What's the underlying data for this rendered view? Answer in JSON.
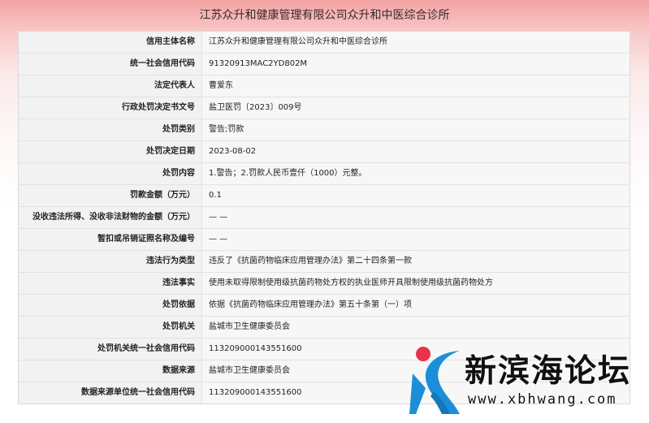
{
  "page": {
    "title": "江苏众升和健康管理有限公司众升和中医综合诊所"
  },
  "rows": [
    {
      "label": "信用主体名称",
      "value": "江苏众升和健康管理有限公司众升和中医综合诊所"
    },
    {
      "label": "统一社会信用代码",
      "value": "91320913MAC2YD802M"
    },
    {
      "label": "法定代表人",
      "value": "曹爱东"
    },
    {
      "label": "行政处罚决定书文号",
      "value": "盐卫医罚〔2023〕009号"
    },
    {
      "label": "处罚类别",
      "value": "警告;罚款"
    },
    {
      "label": "处罚决定日期",
      "value": "2023-08-02"
    },
    {
      "label": "处罚内容",
      "value": "1.警告；2.罚款人民币壹仟（1000）元整。"
    },
    {
      "label": "罚款金额（万元）",
      "value": "0.1"
    },
    {
      "label": "没收违法所得、没收非法财物的金额（万元）",
      "value": "— —"
    },
    {
      "label": "暂扣或吊销证照名称及编号",
      "value": "— —"
    },
    {
      "label": "违法行为类型",
      "value": "违反了《抗菌药物临床应用管理办法》第二十四条第一款"
    },
    {
      "label": "违法事实",
      "value": "使用未取得限制使用级抗菌药物处方权的执业医师开具限制使用级抗菌药物处方"
    },
    {
      "label": "处罚依据",
      "value": "依据《抗菌药物临床应用管理办法》第五十条第（一）项"
    },
    {
      "label": "处罚机关",
      "value": "盐城市卫生健康委员会"
    },
    {
      "label": "处罚机关统一社会信用代码",
      "value": "113209000143551600"
    },
    {
      "label": "数据来源",
      "value": "盐城市卫生健康委员会"
    },
    {
      "label": "数据来源单位统一社会信用代码",
      "value": "113209000143551600"
    }
  ],
  "watermark": {
    "title": "新滨海论坛",
    "url": "www.xbhwang.com",
    "logo_icon": "xbh-logo-icon",
    "colors": {
      "red": "#e8334a",
      "blue": "#1a8fd8"
    }
  }
}
